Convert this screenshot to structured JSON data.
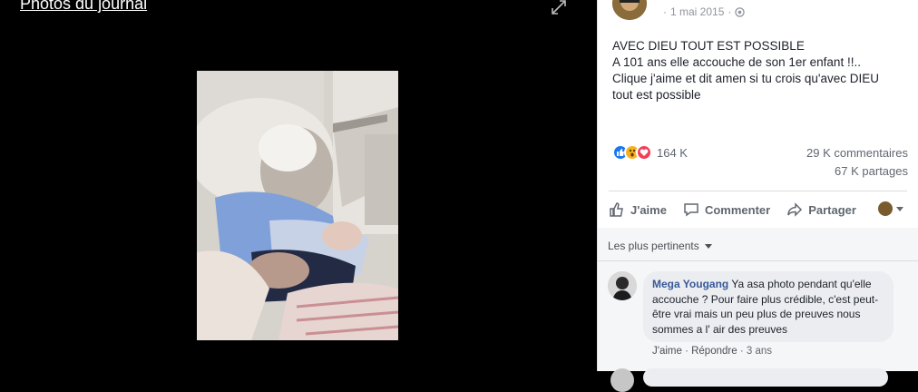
{
  "viewer": {
    "album_title": "Photos du journal"
  },
  "post": {
    "date": "1 mai 2015",
    "separator": "·",
    "text_lines": [
      "AVEC DIEU TOUT EST POSSIBLE",
      "A 101 ans elle accouche de son 1er enfant !!..",
      "Clique j'aime et dit amen si tu crois qu'avec DIEU",
      "tout est possible"
    ],
    "reactions_count": "164 K",
    "comments_count": "29 K commentaires",
    "shares_count": "67 K partages"
  },
  "actions": {
    "like": "J'aime",
    "comment": "Commenter",
    "share": "Partager"
  },
  "comments": {
    "filter_label": "Les plus pertinents",
    "items": [
      {
        "author": "Mega Yougang",
        "text": " Ya asa photo pendant qu'elle accouche ? Pour faire plus crédible, c'est peut-être vrai mais un peu plus de preuves nous sommes a l' air des preuves",
        "like": "J'aime",
        "reply": "Répondre",
        "time": "3 ans"
      }
    ]
  },
  "colors": {
    "link_blue": "#385898",
    "like_blue": "#1877f2",
    "love_red": "#f33e58",
    "wow_yellow": "#f7b125"
  }
}
